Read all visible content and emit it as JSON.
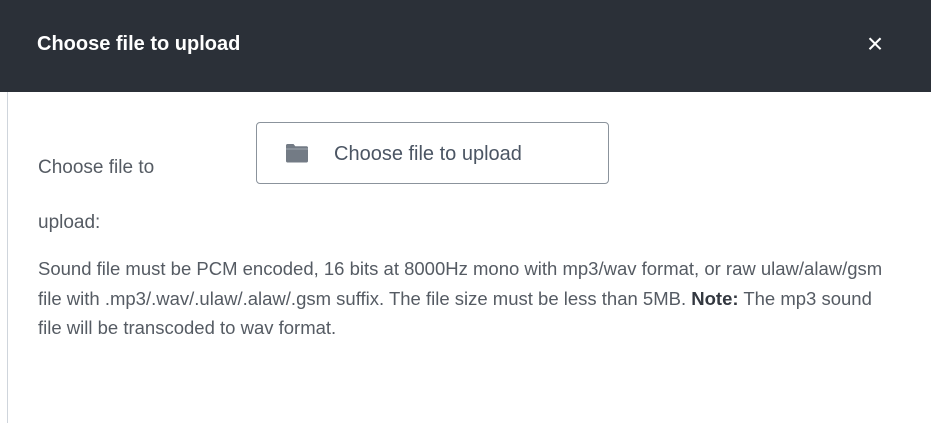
{
  "dialog": {
    "title": "Choose file to upload",
    "close_label": "×"
  },
  "form": {
    "label_line1": "Choose file to",
    "label_line2": "upload:",
    "upload_button_label": "Choose file to upload",
    "upload_button_icon": "folder-icon"
  },
  "description": {
    "part1": "Sound file must be PCM encoded, 16 bits at 8000Hz mono with mp3/wav format, or raw ulaw/alaw/gsm file with .mp3/.wav/.ulaw/.alaw/.gsm suffix. The file size must be less than 5MB. ",
    "note_label": "Note:",
    "part2": " The mp3 sound file will be transcoded to wav format."
  },
  "colors": {
    "header_background": "#2b3038",
    "header_text": "#ffffff",
    "body_text": "#555b63",
    "button_border": "#8b939c",
    "folder_icon": "#737b85"
  }
}
